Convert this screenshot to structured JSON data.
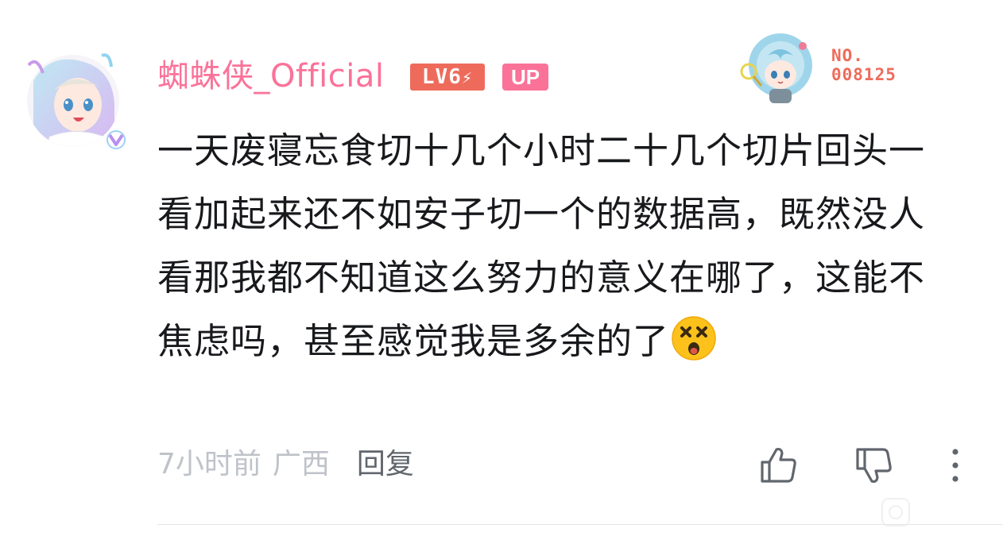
{
  "comment": {
    "username": "蜘蛛侠_Official",
    "level_badge": "LV6",
    "up_badge": "UP",
    "fan_badge_label": "NO.",
    "fan_badge_number": "008125",
    "text": "一天废寝忘食切十几个小时二十几个切片回头一看加起来还不如安子切一个的数据高，既然没人看那我都不知道这么努力的意义在哪了，这能不焦虑吗，甚至感觉我是多余的了",
    "time": "7小时前",
    "location": "广西",
    "reply_label": "回复"
  },
  "colors": {
    "username": "#fb7299",
    "level_badge": "#ee6b5b",
    "meta_text": "#bfc3c9",
    "reply_text": "#61666d",
    "body_text": "#18191c"
  },
  "icons": {
    "like": "thumbs-up-icon",
    "dislike": "thumbs-down-icon",
    "more": "more-vertical-icon",
    "emoji": "dizzy-face-emoji"
  }
}
